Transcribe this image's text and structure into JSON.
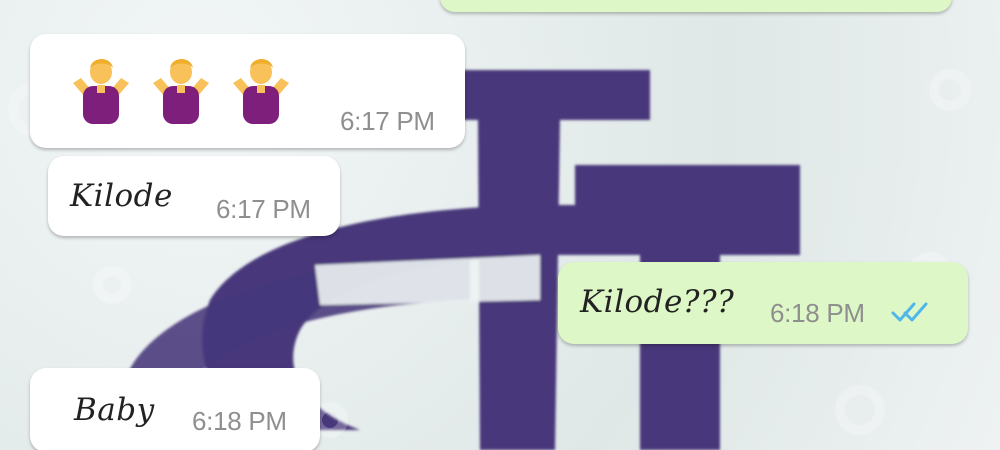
{
  "chat": {
    "messages": [
      {
        "direction": "outgoing",
        "text": "",
        "time": "",
        "status": "cropped"
      },
      {
        "direction": "incoming",
        "text": "🤷‍♂️🤷‍♂️🤷‍♂️",
        "emoji_names": [
          "man-shrugging-icon",
          "man-shrugging-icon",
          "man-shrugging-icon"
        ],
        "time": "6:17 PM"
      },
      {
        "direction": "incoming",
        "text": "Kilode",
        "time": "6:17 PM"
      },
      {
        "direction": "outgoing",
        "text": "Kilode???",
        "time": "6:18 PM",
        "status": "read",
        "status_icon": "double-check-icon"
      },
      {
        "direction": "incoming",
        "text": "Baby",
        "time": "6:18 PM"
      }
    ]
  },
  "theme": {
    "incoming_bubble": "#ffffff",
    "outgoing_bubble": "#ddf7c6",
    "read_ticks": "#4fb6ec",
    "wallpaper_logo": "#3f2d74"
  }
}
